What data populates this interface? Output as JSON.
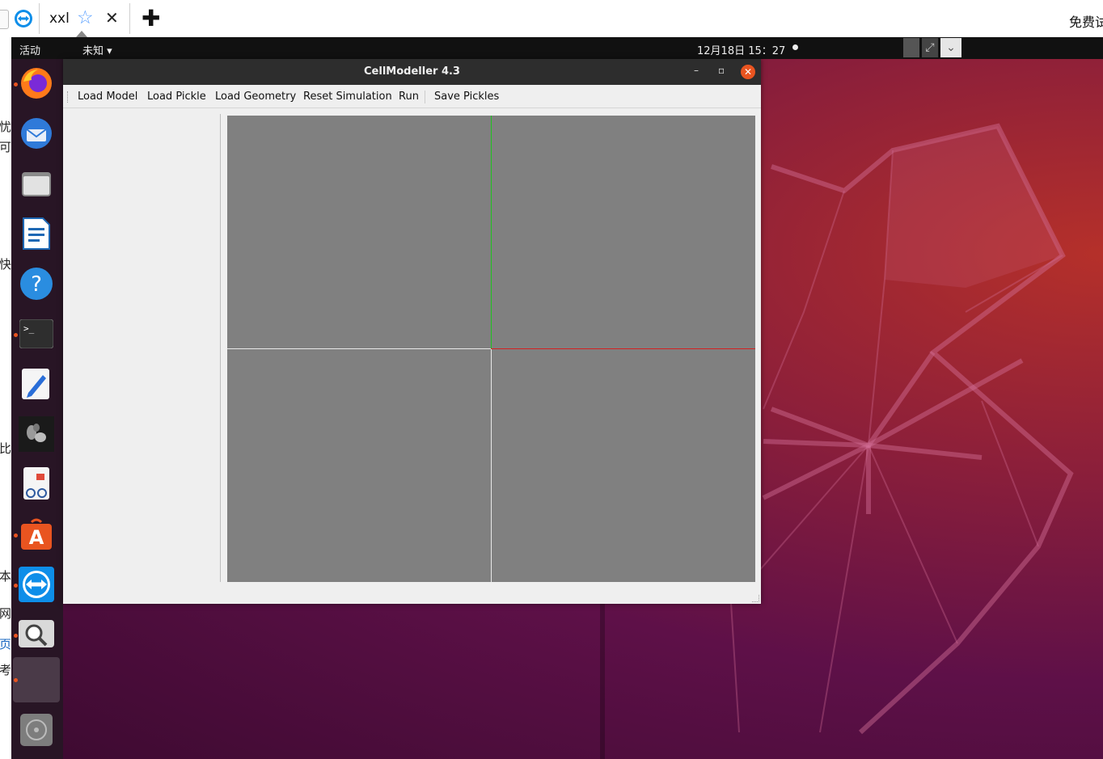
{
  "browser_tab": {
    "title": "xxl",
    "star_icon": "star-outline-icon",
    "close_icon": "close-icon",
    "new_tab_icon": "plus-icon",
    "right_text": "免费试"
  },
  "left_fragments": [
    "忧",
    "可",
    "快",
    "比",
    "本",
    "网",
    "页",
    "考"
  ],
  "ubuntu_topbar": {
    "activities": "活动",
    "app_menu": "未知 ▾",
    "clock": "12月18日  15：27"
  },
  "dock": {
    "items": [
      {
        "name": "firefox-icon",
        "running": true
      },
      {
        "name": "thunderbird-icon",
        "running": false
      },
      {
        "name": "files-icon",
        "running": false
      },
      {
        "name": "writer-icon",
        "running": false
      },
      {
        "name": "help-icon",
        "running": false
      },
      {
        "name": "terminal-icon",
        "running": true
      },
      {
        "name": "text-editor-icon",
        "running": false
      },
      {
        "name": "cellmodeller-icon",
        "running": false
      },
      {
        "name": "document-viewer-icon",
        "running": false
      },
      {
        "name": "software-center-icon",
        "running": true
      },
      {
        "name": "teamviewer-icon",
        "running": true
      },
      {
        "name": "image-viewer-icon",
        "running": true
      },
      {
        "name": "active-window-slot",
        "running": true
      },
      {
        "name": "disc-icon",
        "running": false
      }
    ]
  },
  "window": {
    "title": "CellModeller 4.3",
    "minimize": "–",
    "maximize": "▫",
    "close": "✕"
  },
  "toolbar": {
    "load_model": "Load Model",
    "load_pickle": "Load Pickle",
    "load_geometry": "Load Geometry",
    "reset_simulation": "Reset Simulation",
    "run": "Run",
    "save_pickles": "Save Pickles"
  },
  "colors": {
    "gl_background": "#808080",
    "y_axis": "#1fc21f",
    "x_axis": "#d42020",
    "grid_line": "#e8e8e8",
    "ubuntu_orange": "#e95420"
  }
}
